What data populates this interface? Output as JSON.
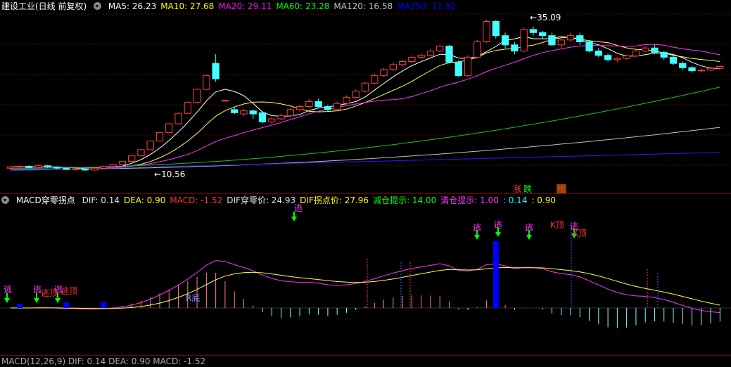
{
  "main_pane": {
    "title": "建设工业(日线 前复权)",
    "indicators": [
      {
        "label": "MA5: 26.23",
        "color": "#ffffff"
      },
      {
        "label": "MA10: 27.68",
        "color": "#ffff00"
      },
      {
        "label": "MA20: 29.11",
        "color": "#ff00ff"
      },
      {
        "label": "MA60: 23.28",
        "color": "#00ff00"
      },
      {
        "label": "MA120: 16.58",
        "color": "#c0c0c0"
      },
      {
        "label": "MA250: 12.92",
        "color": "#0000ff"
      }
    ],
    "high_marker": "35.09",
    "low_marker": "10.56",
    "badges": [
      {
        "text": "涨",
        "color": "#ff3030"
      },
      {
        "text": "跌",
        "color": "#00ff00"
      },
      {
        "text": "榜",
        "color": "#ff3030"
      }
    ]
  },
  "macd_pane": {
    "title": "MACD穿零拐点",
    "indicators": [
      {
        "label": "DIF: 0.14",
        "color": "#e0e0e0"
      },
      {
        "label": "DEA: 0.90",
        "color": "#ffff00"
      },
      {
        "label": "MACD: -1.52",
        "color": "#ff3030"
      },
      {
        "label": "DIF穿零价: 24.93",
        "color": "#e0e0e0"
      },
      {
        "label": "DIF拐点价: 27.96",
        "color": "#ffff00"
      },
      {
        "label": "减仓提示: 14.00",
        "color": "#00ff00"
      },
      {
        "label": "清仓提示: 1.00",
        "color": "#ff33ff"
      },
      {
        "label": ": 0.14",
        "color": "#00ffff"
      },
      {
        "label": ": 0.90",
        "color": "#ffff00"
      }
    ],
    "signals": {
      "escape": "逃",
      "r_bottom": "R底",
      "k_top": "K顶",
      "escape_top_partial": "逃顶",
      "hidden_tail": "逃"
    }
  },
  "third_pane": {
    "title_partial": "MACD(12,26,9)  DIF: 0.14  DEA: 0.90  MACD: -1.52"
  },
  "chart_data": {
    "type": "candlestick",
    "title": "建设工业(日线 前复权)",
    "xlabel": "",
    "ylabel": "",
    "price_high": 35.09,
    "price_low": 10.56,
    "ylim": [
      10,
      36
    ],
    "moving_averages": [
      "MA5",
      "MA10",
      "MA20",
      "MA60",
      "MA120",
      "MA250"
    ],
    "candles": [
      {
        "o": 11.0,
        "c": 11.2,
        "h": 11.4,
        "l": 10.8
      },
      {
        "o": 11.2,
        "c": 11.3,
        "h": 11.5,
        "l": 11.0
      },
      {
        "o": 11.3,
        "c": 11.1,
        "h": 11.5,
        "l": 11.0
      },
      {
        "o": 11.1,
        "c": 11.4,
        "h": 11.6,
        "l": 11.0
      },
      {
        "o": 11.4,
        "c": 11.2,
        "h": 11.5,
        "l": 11.0
      },
      {
        "o": 11.2,
        "c": 11.0,
        "h": 11.3,
        "l": 10.8
      },
      {
        "o": 11.0,
        "c": 10.8,
        "h": 11.1,
        "l": 10.7
      },
      {
        "o": 10.8,
        "c": 10.9,
        "h": 11.0,
        "l": 10.6
      },
      {
        "o": 10.9,
        "c": 10.7,
        "h": 11.0,
        "l": 10.56
      },
      {
        "o": 10.7,
        "c": 11.0,
        "h": 11.1,
        "l": 10.6
      },
      {
        "o": 11.0,
        "c": 11.3,
        "h": 11.4,
        "l": 10.9
      },
      {
        "o": 11.3,
        "c": 11.6,
        "h": 11.7,
        "l": 11.2
      },
      {
        "o": 11.6,
        "c": 12.1,
        "h": 12.2,
        "l": 11.5
      },
      {
        "o": 12.1,
        "c": 13.0,
        "h": 13.1,
        "l": 12.0
      },
      {
        "o": 13.0,
        "c": 14.0,
        "h": 14.1,
        "l": 12.9
      },
      {
        "o": 14.0,
        "c": 15.4,
        "h": 15.5,
        "l": 13.9
      },
      {
        "o": 15.4,
        "c": 16.8,
        "h": 16.9,
        "l": 15.3
      },
      {
        "o": 16.8,
        "c": 18.2,
        "h": 18.3,
        "l": 16.7
      },
      {
        "o": 18.2,
        "c": 19.9,
        "h": 20.0,
        "l": 18.1
      },
      {
        "o": 19.9,
        "c": 21.7,
        "h": 21.8,
        "l": 19.8
      },
      {
        "o": 21.7,
        "c": 23.8,
        "h": 23.9,
        "l": 21.6
      },
      {
        "o": 23.8,
        "c": 26.0,
        "h": 26.1,
        "l": 23.7
      },
      {
        "o": 28.0,
        "c": 25.5,
        "h": 29.5,
        "l": 25.0
      },
      {
        "o": 22.0,
        "c": 22.0,
        "h": 22.1,
        "l": 21.9
      },
      {
        "o": 20.5,
        "c": 20.0,
        "h": 21.0,
        "l": 19.8
      },
      {
        "o": 19.8,
        "c": 20.3,
        "h": 20.6,
        "l": 19.5
      },
      {
        "o": 20.3,
        "c": 19.8,
        "h": 20.5,
        "l": 19.0
      },
      {
        "o": 20.0,
        "c": 18.5,
        "h": 20.2,
        "l": 18.3
      },
      {
        "o": 18.5,
        "c": 19.0,
        "h": 19.3,
        "l": 18.2
      },
      {
        "o": 19.0,
        "c": 19.5,
        "h": 19.8,
        "l": 18.8
      },
      {
        "o": 19.5,
        "c": 20.5,
        "h": 20.8,
        "l": 19.3
      },
      {
        "o": 20.5,
        "c": 21.0,
        "h": 21.3,
        "l": 20.2
      },
      {
        "o": 21.0,
        "c": 21.8,
        "h": 22.2,
        "l": 20.8
      },
      {
        "o": 21.8,
        "c": 21.0,
        "h": 22.3,
        "l": 20.7
      },
      {
        "o": 21.0,
        "c": 20.5,
        "h": 21.3,
        "l": 20.2
      },
      {
        "o": 20.5,
        "c": 21.5,
        "h": 21.8,
        "l": 20.3
      },
      {
        "o": 21.5,
        "c": 22.5,
        "h": 22.8,
        "l": 21.3
      },
      {
        "o": 22.5,
        "c": 23.5,
        "h": 23.8,
        "l": 22.3
      },
      {
        "o": 23.5,
        "c": 24.8,
        "h": 25.0,
        "l": 23.3
      },
      {
        "o": 24.8,
        "c": 26.0,
        "h": 26.3,
        "l": 24.6
      },
      {
        "o": 26.0,
        "c": 27.0,
        "h": 27.3,
        "l": 25.8
      },
      {
        "o": 27.0,
        "c": 27.8,
        "h": 28.2,
        "l": 26.8
      },
      {
        "o": 27.8,
        "c": 28.3,
        "h": 28.6,
        "l": 27.5
      },
      {
        "o": 28.3,
        "c": 29.0,
        "h": 29.3,
        "l": 28.0
      },
      {
        "o": 29.0,
        "c": 29.3,
        "h": 29.6,
        "l": 28.7
      },
      {
        "o": 29.3,
        "c": 30.0,
        "h": 30.3,
        "l": 29.1
      },
      {
        "o": 30.0,
        "c": 30.8,
        "h": 31.0,
        "l": 29.8
      },
      {
        "o": 30.8,
        "c": 28.2,
        "h": 31.0,
        "l": 28.0
      },
      {
        "o": 28.2,
        "c": 26.0,
        "h": 28.5,
        "l": 25.8
      },
      {
        "o": 26.0,
        "c": 29.0,
        "h": 29.3,
        "l": 25.7
      },
      {
        "o": 29.0,
        "c": 31.5,
        "h": 31.8,
        "l": 28.8
      },
      {
        "o": 31.5,
        "c": 34.8,
        "h": 35.09,
        "l": 31.3
      },
      {
        "o": 34.8,
        "c": 32.5,
        "h": 35.0,
        "l": 32.0
      },
      {
        "o": 32.5,
        "c": 31.0,
        "h": 33.0,
        "l": 30.5
      },
      {
        "o": 31.0,
        "c": 30.0,
        "h": 31.5,
        "l": 29.5
      },
      {
        "o": 30.0,
        "c": 33.5,
        "h": 33.8,
        "l": 29.8
      },
      {
        "o": 33.5,
        "c": 33.0,
        "h": 34.0,
        "l": 32.5
      },
      {
        "o": 33.0,
        "c": 32.5,
        "h": 33.3,
        "l": 32.0
      },
      {
        "o": 32.5,
        "c": 31.0,
        "h": 33.0,
        "l": 30.8
      },
      {
        "o": 31.0,
        "c": 31.8,
        "h": 32.0,
        "l": 30.5
      },
      {
        "o": 31.8,
        "c": 32.5,
        "h": 33.0,
        "l": 31.5
      },
      {
        "o": 32.5,
        "c": 31.5,
        "h": 33.0,
        "l": 31.0
      },
      {
        "o": 31.5,
        "c": 30.0,
        "h": 31.8,
        "l": 29.8
      },
      {
        "o": 30.0,
        "c": 29.3,
        "h": 30.5,
        "l": 29.0
      },
      {
        "o": 29.3,
        "c": 28.6,
        "h": 29.6,
        "l": 28.3
      },
      {
        "o": 28.6,
        "c": 28.8,
        "h": 29.0,
        "l": 28.2
      },
      {
        "o": 28.8,
        "c": 29.2,
        "h": 29.4,
        "l": 28.6
      },
      {
        "o": 29.2,
        "c": 30.0,
        "h": 30.2,
        "l": 29.0
      },
      {
        "o": 30.0,
        "c": 30.5,
        "h": 30.8,
        "l": 29.8
      },
      {
        "o": 30.5,
        "c": 29.8,
        "h": 31.0,
        "l": 29.5
      },
      {
        "o": 29.8,
        "c": 29.0,
        "h": 30.0,
        "l": 28.6
      },
      {
        "o": 29.0,
        "c": 28.0,
        "h": 29.3,
        "l": 27.7
      },
      {
        "o": 28.0,
        "c": 27.3,
        "h": 28.3,
        "l": 27.0
      },
      {
        "o": 27.3,
        "c": 26.8,
        "h": 27.6,
        "l": 26.5
      },
      {
        "o": 26.8,
        "c": 26.9,
        "h": 27.2,
        "l": 26.5
      },
      {
        "o": 26.9,
        "c": 27.2,
        "h": 27.5,
        "l": 26.7
      },
      {
        "o": 27.2,
        "c": 27.5,
        "h": 27.8,
        "l": 27.0
      }
    ]
  }
}
